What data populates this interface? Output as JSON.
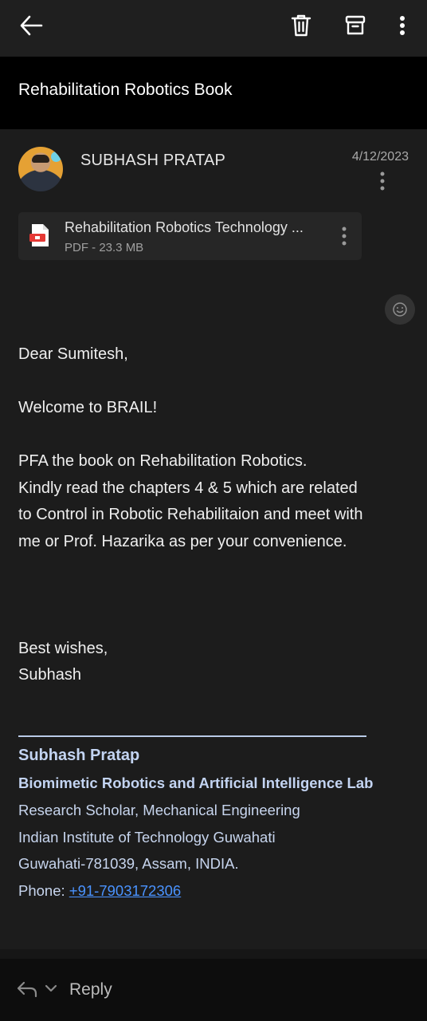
{
  "toolbar": {
    "back_icon": "back-arrow-icon",
    "delete_icon": "trash-icon",
    "archive_icon": "archive-icon",
    "more_icon": "more-vert-icon"
  },
  "email": {
    "subject": "Rehabilitation Robotics Book",
    "sender": "SUBHASH PRATAP",
    "date": "4/12/2023",
    "attachment": {
      "name": "Rehabilitation Robotics Technology ...",
      "meta": "PDF - 23.3 MB"
    },
    "body": {
      "greeting": "Dear Sumitesh,",
      "welcome": "Welcome to BRAIL!",
      "para_lines": [
        "PFA the book on Rehabilitation Robotics.",
        "Kindly read the chapters 4 & 5 which are related",
        "to Control in Robotic Rehabilitaion and meet with",
        "me or Prof. Hazarika as per your convenience."
      ],
      "closing": "Best wishes,",
      "closing_name": "Subhash"
    },
    "signature": {
      "name": "Subhash Pratap",
      "lab": "Biomimetic Robotics and Artificial Intelligence Lab",
      "role": "Research Scholar, Mechanical Engineering",
      "institute": "Indian Institute of Technology Guwahati",
      "address": "Guwahati-781039, Assam, INDIA.",
      "phone_label": "Phone: ",
      "phone": "+91-7903172306"
    }
  },
  "bottom": {
    "reply_label": "Reply"
  },
  "colors": {
    "background": "#1c1c1c",
    "subject_bar": "#000000",
    "signature_text": "#c3d4f2",
    "link": "#4a93ff"
  }
}
